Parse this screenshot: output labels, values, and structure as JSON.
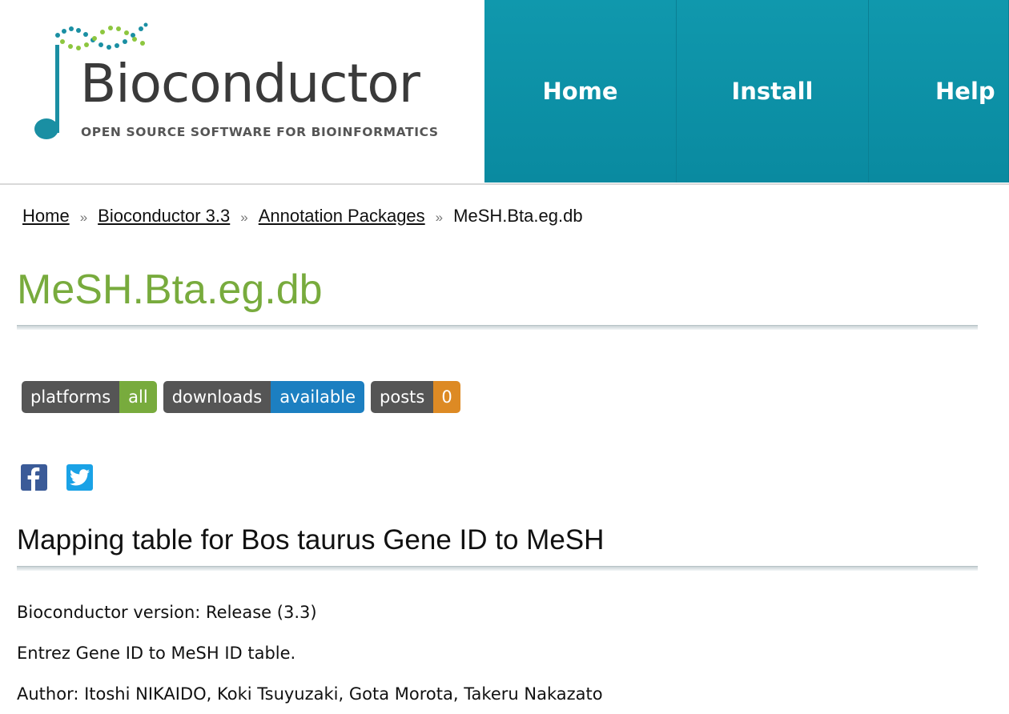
{
  "logo": {
    "wordmark": "Bioconductor",
    "tagline": "OPEN SOURCE SOFTWARE FOR BIOINFORMATICS"
  },
  "nav": {
    "items": [
      {
        "label": "Home"
      },
      {
        "label": "Install"
      },
      {
        "label": "Help"
      }
    ]
  },
  "breadcrumb": {
    "items": [
      {
        "label": "Home"
      },
      {
        "label": "Bioconductor 3.3"
      },
      {
        "label": "Annotation Packages"
      }
    ],
    "separator": "»",
    "current": "MeSH.Bta.eg.db"
  },
  "page": {
    "title": "MeSH.Bta.eg.db",
    "subtitle": "Mapping table for Bos taurus Gene ID to MeSH",
    "version_line": "Bioconductor version: Release (3.3)",
    "description": "Entrez Gene ID to MeSH ID table.",
    "author_line": "Author: Itoshi NIKAIDO, Koki Tsuyuzaki, Gota Morota, Takeru Nakazato"
  },
  "badges": [
    {
      "key": "platforms",
      "value": "all",
      "color": "#78ab3d"
    },
    {
      "key": "downloads",
      "value": "available",
      "color": "#1c7fc1"
    },
    {
      "key": "posts",
      "value": "0",
      "color": "#dd8a24"
    }
  ],
  "social": {
    "icons": [
      "facebook-icon",
      "twitter-icon"
    ]
  },
  "colors": {
    "nav_bg": "#0a8ea3",
    "title_green": "#78ab3d"
  }
}
